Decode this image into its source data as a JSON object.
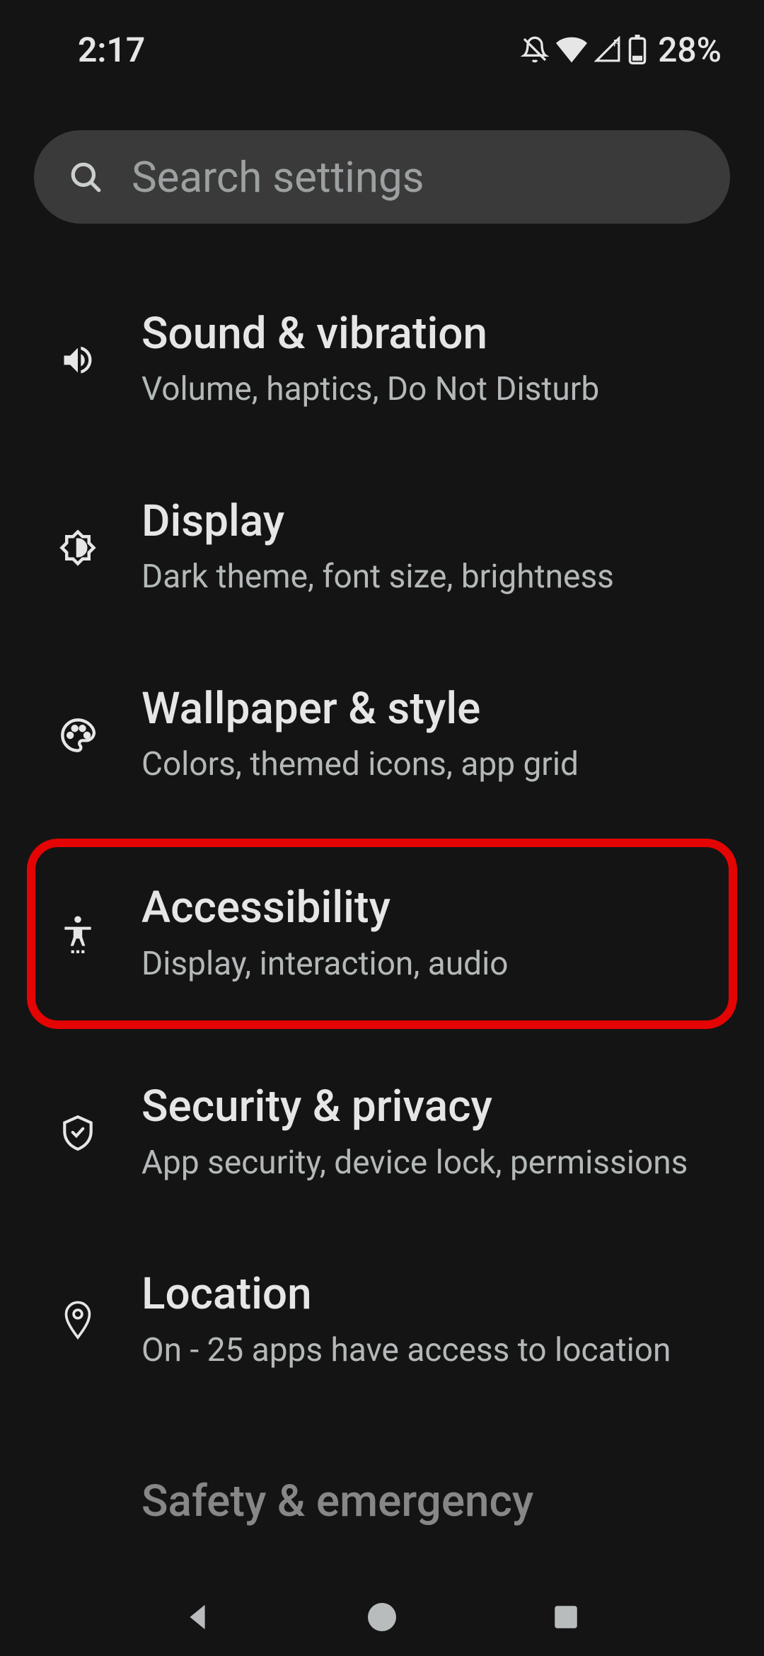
{
  "status": {
    "time": "2:17",
    "battery": "28%"
  },
  "search": {
    "placeholder": "Search settings"
  },
  "items": [
    {
      "title": "Sound & vibration",
      "sub": "Volume, haptics, Do Not Disturb"
    },
    {
      "title": "Display",
      "sub": "Dark theme, font size, brightness"
    },
    {
      "title": "Wallpaper & style",
      "sub": "Colors, themed icons, app grid"
    },
    {
      "title": "Accessibility",
      "sub": "Display, interaction, audio"
    },
    {
      "title": "Security & privacy",
      "sub": "App security, device lock, permissions"
    },
    {
      "title": "Location",
      "sub": "On - 25 apps have access to location"
    },
    {
      "title": "Safety & emergency",
      "sub": ""
    }
  ]
}
